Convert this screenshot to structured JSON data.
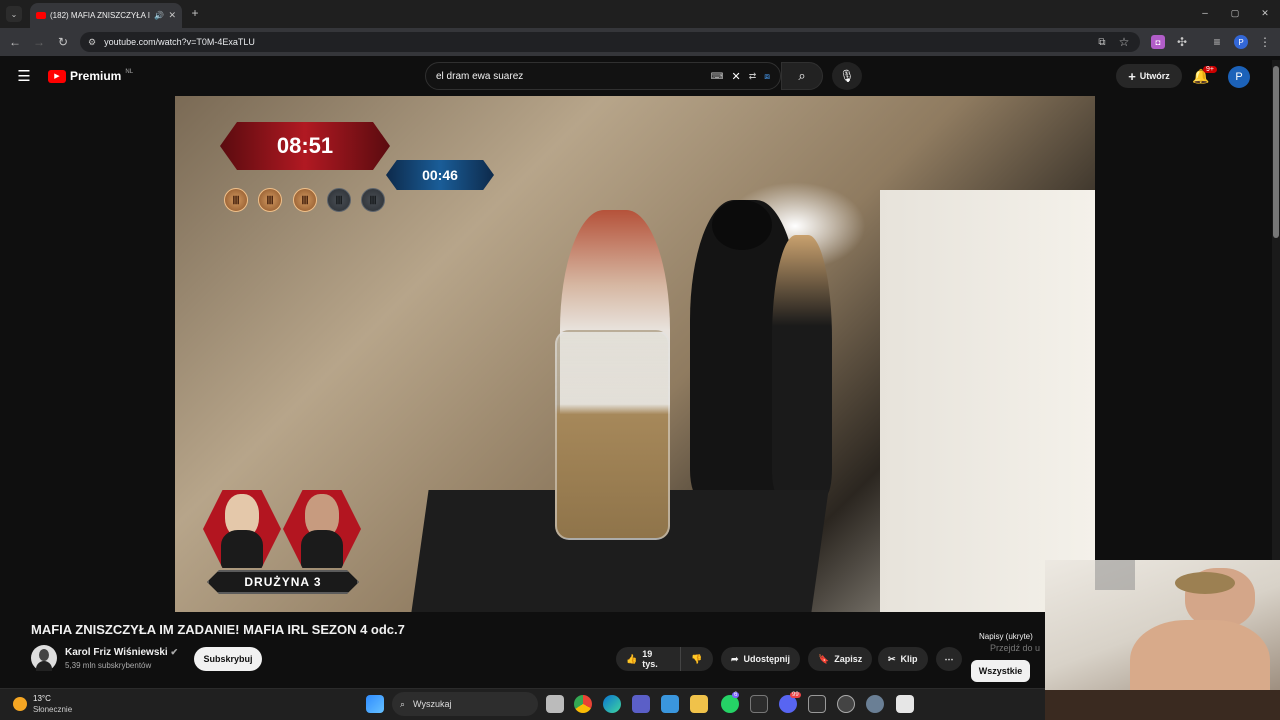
{
  "browser": {
    "tab_title": "(182) MAFIA ZNISZCZYŁA I",
    "url": "youtube.com/watch?v=T0M-4ExaTLU"
  },
  "youtube": {
    "logo": "Premium",
    "region": "NL",
    "search_query": "el dram ewa suarez",
    "create_label": "Utwórz",
    "notifications": "9+",
    "profile_initial": "P"
  },
  "video": {
    "timer_main": "08:51",
    "timer_secondary": "00:46",
    "team_label": "DRUŻYNA 3",
    "coins_total": 5,
    "coins_active": 3
  },
  "info": {
    "title": "MAFIA ZNISZCZYŁA IM ZADANIE! MAFIA IRL SEZON 4 odc.7",
    "channel": "Karol Friz Wiśniewski",
    "subscribers": "5,39 mln subskrybentów",
    "subscribe_label": "Subskrybuj",
    "likes": "19 tys.",
    "share_label": "Udostępnij",
    "save_label": "Zapisz",
    "clip_label": "Klip",
    "side_caption": "Napisy (ukryte)",
    "side_caption_sub": "Przejdź do u",
    "all_label": "Wszystkie"
  },
  "taskbar": {
    "temperature": "13°C",
    "weather": "Słonecznie",
    "search_label": "Wyszukaj",
    "badge1": "6",
    "badge2": "99"
  },
  "colors": {
    "brand_red": "#ff0000",
    "bg": "#0f0f0f"
  }
}
